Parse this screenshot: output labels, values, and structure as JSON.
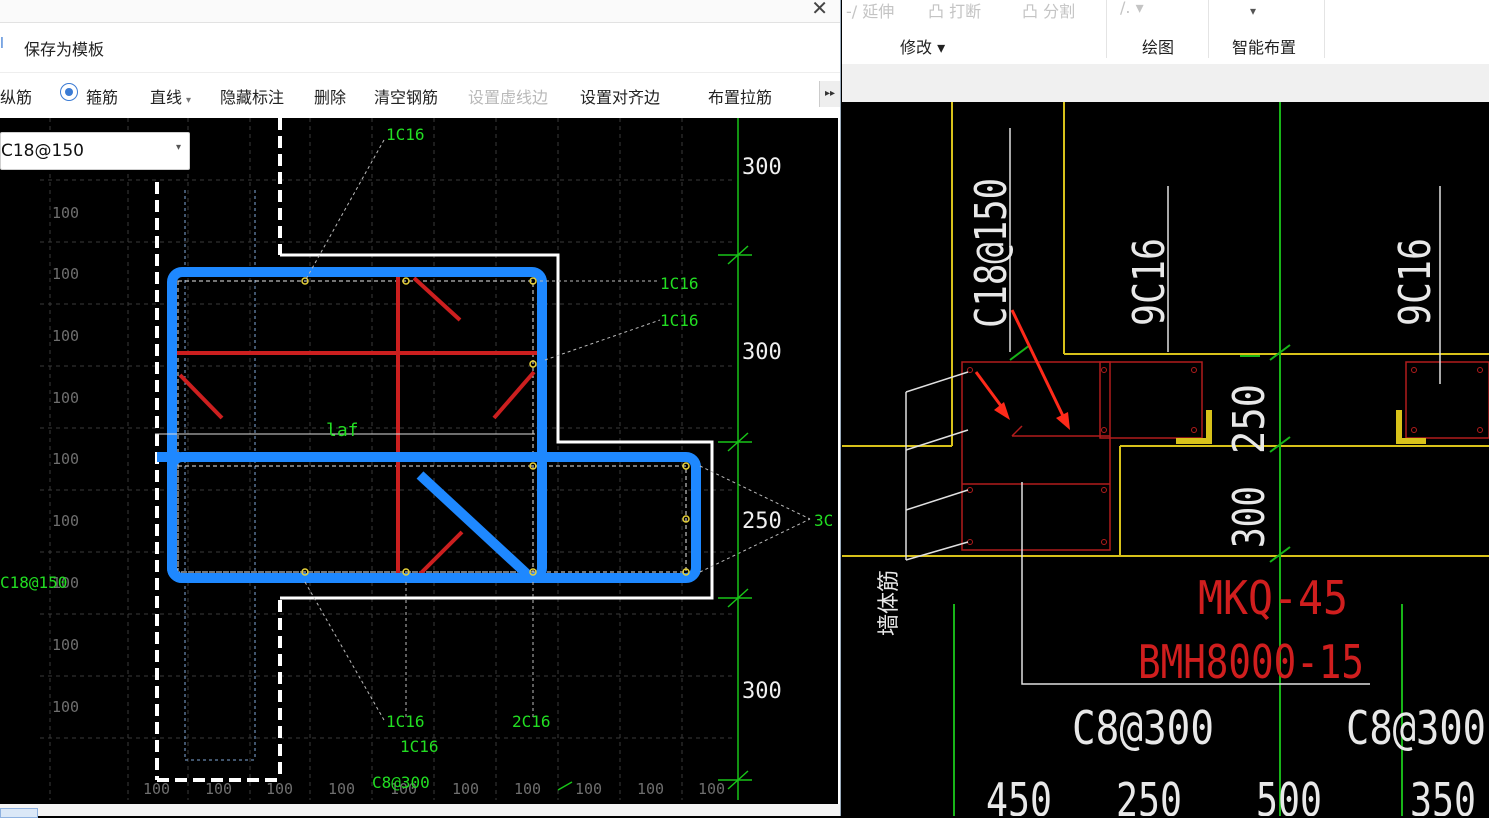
{
  "dialog": {
    "close_symbol": "✕",
    "save_template_label": "保存为模板",
    "edge_label": "l",
    "toolbar": {
      "item0": "纵筋",
      "item1_radio": "箍筋",
      "item2": "直线",
      "item3": "隐藏标注",
      "item4": "删除",
      "item5": "清空钢筋",
      "item6_disabled": "设置虚线边",
      "item7": "设置对齐边",
      "item8": "布置拉筋",
      "more": "▸▸"
    },
    "spec_select_value": "C18@150",
    "canvas": {
      "grid_labels_left": [
        "100",
        "100",
        "100",
        "100",
        "100",
        "100",
        "100",
        "100",
        "100"
      ],
      "grid_labels_bottom": [
        "100",
        "100",
        "100",
        "100",
        "100",
        "100",
        "100",
        "100",
        "100",
        "100"
      ],
      "dims_right": [
        "300",
        "300",
        "250",
        "300"
      ],
      "annotations": {
        "a1": "1C16",
        "a2": "1C16",
        "a3": "1C16",
        "a4": "laf",
        "a5": "3C",
        "a6": "C18@150",
        "a7": "1C16",
        "a8": "1C16",
        "a9": "2C16",
        "a10": "C8@300"
      }
    }
  },
  "ribbon": {
    "faint1": "-/ 延伸",
    "faint2": "凸 打断",
    "faint3": "凸 分割",
    "faint4": "/. ▾",
    "faint5": "▾",
    "group_modify": "修改 ▾",
    "group_draw": "绘图",
    "group_smart": "智能布置"
  },
  "drawing": {
    "col_label1": "C18@150",
    "col_label2": "9C16",
    "col_label3": "9C16",
    "dim1": "250",
    "dim2": "300",
    "wall_label": "墙体筋",
    "mark1": "MKQ-45",
    "mark2": "BMH8000-15",
    "spec1": "C8@300",
    "spec2": "C8@300",
    "bottom_dims": [
      "450",
      "250",
      "500",
      "350"
    ]
  },
  "colors": {
    "stirrup": "#1e88ff",
    "rebar": "#cc1f1f",
    "annotation": "#22dd22",
    "dimension": "#18c418",
    "wall_outline": "#d8c21a"
  }
}
